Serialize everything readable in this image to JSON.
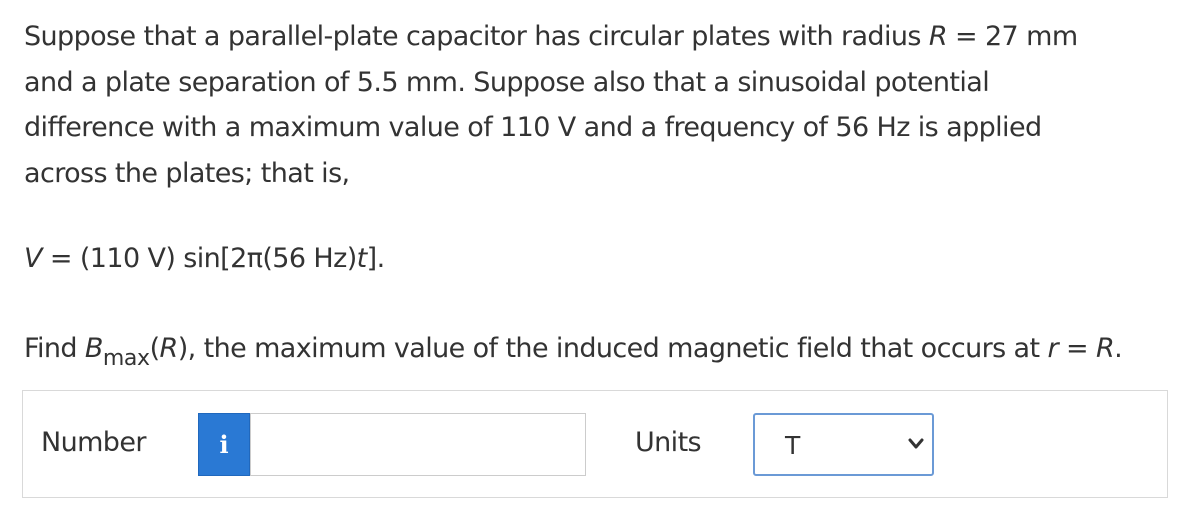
{
  "problem": {
    "line1_a": "Suppose that a parallel-plate capacitor has circular plates with radius ",
    "line1_var": "R",
    "line1_b": " = 27 mm",
    "line2": "and a plate separation of 5.5 mm. Suppose also that a sinusoidal potential",
    "line3": "difference with a maximum value of 110 V and a frequency of 56 Hz is applied",
    "line4": "across the plates; that is,"
  },
  "equation": {
    "var_v": "V",
    "middle": " = (110 V) sin[2π(56 Hz)",
    "var_t": "t",
    "end": "]."
  },
  "question": {
    "prefix": "Find ",
    "var_b": "B",
    "subscript": "max",
    "arg_open": "(",
    "arg_var": "R",
    "rest": "), the maximum value of the induced magnetic field that occurs at ",
    "var_r": "r",
    "equals": " = ",
    "var_r2": "R",
    "period": "."
  },
  "answer": {
    "number_label": "Number",
    "info_icon_char": "i",
    "number_value": "",
    "units_label": "Units",
    "units_selected": "T"
  },
  "colors": {
    "info_button_bg": "#2a79d4",
    "select_border": "#6b9ad6",
    "text": "#333333"
  },
  "icons": {
    "info": "info-icon",
    "dropdown": "chevron-down-icon"
  }
}
